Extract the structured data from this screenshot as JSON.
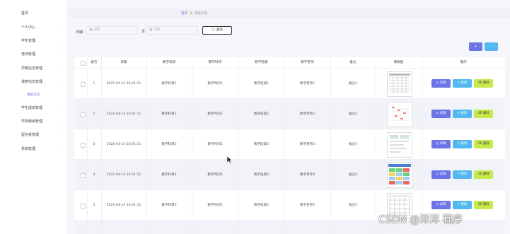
{
  "sidebar": {
    "items": [
      {
        "label": "首页",
        "chevron": false
      },
      {
        "label": "个人中心",
        "chevron": true
      },
      {
        "label": "学生管理",
        "chevron": true
      },
      {
        "label": "老师管理",
        "chevron": true
      },
      {
        "label": "学籍信息管理",
        "chevron": true
      },
      {
        "label": "课表信息管理",
        "chevron": true,
        "expanded": true
      },
      {
        "label": "课表信息",
        "sub": true
      },
      {
        "label": "学生成绩管理",
        "chevron": true
      },
      {
        "label": "学费缴纳管理",
        "chevron": true
      },
      {
        "label": "留言板管理",
        "chevron": true
      },
      {
        "label": "系统管理",
        "chevron": true
      }
    ]
  },
  "breadcrumb": {
    "home": "首页",
    "current": "课表信息"
  },
  "search": {
    "label": "日期",
    "start_placeholder": "日期",
    "separator": "至",
    "end_placeholder": "日期",
    "query_label": "查询"
  },
  "toolbar": {
    "add_label": "+",
    "delete_label": "-"
  },
  "table": {
    "headers": [
      "索引",
      "日期",
      "教学科目",
      "教学时间",
      "教学班级",
      "教学老师",
      "备注",
      "课表图",
      "操作"
    ],
    "rows": [
      {
        "index": "1",
        "date": "2021-04-14 16:01:11",
        "subject": "教学科目1",
        "time": "教学时间1",
        "class": "教学班级1",
        "teacher": "教学老师1",
        "remark": "备注1"
      },
      {
        "index": "2",
        "date": "2021-04-14 16:01:11",
        "subject": "教学科目2",
        "time": "教学时间2",
        "class": "教学班级2",
        "teacher": "教学老师2",
        "remark": "备注2"
      },
      {
        "index": "3",
        "date": "2021-04-14 16:01:11",
        "subject": "教学科目3",
        "time": "教学时间3",
        "class": "教学班级3",
        "teacher": "教学老师3",
        "remark": "备注3"
      },
      {
        "index": "4",
        "date": "2021-04-14 16:01:11",
        "subject": "教学科目4",
        "time": "教学时间4",
        "class": "教学班级4",
        "teacher": "教学老师4",
        "remark": "备注4"
      },
      {
        "index": "5",
        "date": "2021-04-14 16:01:11",
        "subject": "教学科目5",
        "time": "教学时间5",
        "class": "教学班级5",
        "teacher": "教学老师5",
        "remark": "备注5"
      }
    ],
    "actions": {
      "detail": "详情",
      "edit": "修改",
      "delete": "删除"
    }
  },
  "watermark": "CSDN @洋洋 程序",
  "colors": {
    "accent": "#6c74e8",
    "edit": "#53b8ef",
    "delete": "#c6ea4b"
  }
}
